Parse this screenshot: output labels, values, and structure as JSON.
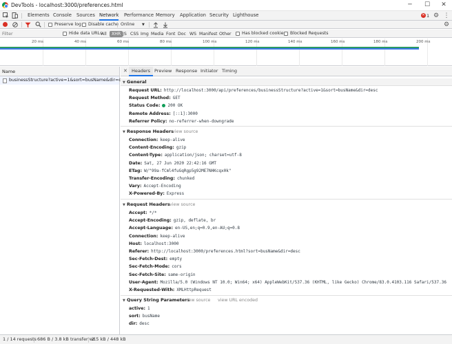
{
  "window": {
    "title": "DevTools - localhost:3000/preferences.html",
    "minimize": "─",
    "maximize": "☐",
    "close": "✕"
  },
  "panels": [
    "Elements",
    "Console",
    "Sources",
    "Network",
    "Performance",
    "Memory",
    "Application",
    "Security",
    "Lighthouse"
  ],
  "errors_count": "1",
  "toolbar": {
    "preserve_log": "Preserve log",
    "disable_cache": "Disable cache",
    "throttle": "Online"
  },
  "filter": {
    "placeholder": "Filter",
    "hide_data_urls": "Hide data URLs",
    "types": [
      "All",
      "XHR",
      "JS",
      "CSS",
      "Img",
      "Media",
      "Font",
      "Doc",
      "WS",
      "Manifest",
      "Other"
    ],
    "active_type": "XHR",
    "has_blocked_cookies": "Has blocked cookies",
    "blocked_requests": "Blocked Requests"
  },
  "overview": {
    "ticks": [
      "20 ms",
      "40 ms",
      "60 ms",
      "80 ms",
      "100 ms",
      "120 ms",
      "140 ms",
      "160 ms",
      "180 ms",
      "200 ms"
    ],
    "colors": {
      "bar_green": "#2d9b62",
      "bar_blue": "#3b78e7"
    }
  },
  "request_list": {
    "header": "Name",
    "rows": [
      "businessStructure?active=1&sort=busName&dir=desc"
    ]
  },
  "detail_tabs": [
    "Headers",
    "Preview",
    "Response",
    "Initiator",
    "Timing"
  ],
  "close_icon": "✕",
  "general": {
    "title": "General",
    "rows": [
      {
        "k": "Request URL:",
        "v": "http://localhost:3000/api/preferences/businessStructure?active=1&sort=busName&dir=desc"
      },
      {
        "k": "Request Method:",
        "v": "GET"
      },
      {
        "k": "Status Code:",
        "v": "200 OK"
      },
      {
        "k": "Remote Address:",
        "v": "[::1]:3000"
      },
      {
        "k": "Referrer Policy:",
        "v": "no-referrer-when-downgrade"
      }
    ]
  },
  "response_headers": {
    "title": "Response Headers",
    "view_source": "view source",
    "rows": [
      {
        "k": "Connection:",
        "v": "keep-alive"
      },
      {
        "k": "Content-Encoding:",
        "v": "gzip"
      },
      {
        "k": "Content-Type:",
        "v": "application/json; charset=utf-8"
      },
      {
        "k": "Date:",
        "v": "Sat, 27 Jun 2020 22:42:16 GMT"
      },
      {
        "k": "ETag:",
        "v": "W/\"99a-fCml4fuGqRgp5g92ME7NHKcqx0k\""
      },
      {
        "k": "Transfer-Encoding:",
        "v": "chunked"
      },
      {
        "k": "Vary:",
        "v": "Accept-Encoding"
      },
      {
        "k": "X-Powered-By:",
        "v": "Express"
      }
    ]
  },
  "request_headers": {
    "title": "Request Headers",
    "view_source": "view source",
    "rows": [
      {
        "k": "Accept:",
        "v": "*/*"
      },
      {
        "k": "Accept-Encoding:",
        "v": "gzip, deflate, br"
      },
      {
        "k": "Accept-Language:",
        "v": "en-US,en;q=0.9,en-AU;q=0.8"
      },
      {
        "k": "Connection:",
        "v": "keep-alive"
      },
      {
        "k": "Host:",
        "v": "localhost:3000"
      },
      {
        "k": "Referer:",
        "v": "http://localhost:3000/preferences.html?sort=busName&dir=desc"
      },
      {
        "k": "Sec-Fetch-Dest:",
        "v": "empty"
      },
      {
        "k": "Sec-Fetch-Mode:",
        "v": "cors"
      },
      {
        "k": "Sec-Fetch-Site:",
        "v": "same-origin"
      },
      {
        "k": "User-Agent:",
        "v": "Mozilla/5.0 (Windows NT 10.0; Win64; x64) AppleWebKit/537.36 (KHTML, like Gecko) Chrome/83.0.4103.116 Safari/537.36"
      },
      {
        "k": "X-Requested-With:",
        "v": "XMLHttpRequest"
      }
    ]
  },
  "query_params": {
    "title": "Query String Parameters",
    "view_source": "view source",
    "view_url_encoded": "view URL encoded",
    "rows": [
      {
        "k": "active:",
        "v": "1"
      },
      {
        "k": "sort:",
        "v": "busName"
      },
      {
        "k": "dir:",
        "v": "desc"
      }
    ]
  },
  "status": {
    "requests": "1 / 14 requests",
    "transferred": "686 B / 3.8 kB transferred",
    "resources": "2.5 kB / 448 kB"
  },
  "colors": {
    "accent": "#1a73e8",
    "record_red": "#d93025",
    "error_red": "#d93025",
    "status_green": "#0f9d58"
  }
}
